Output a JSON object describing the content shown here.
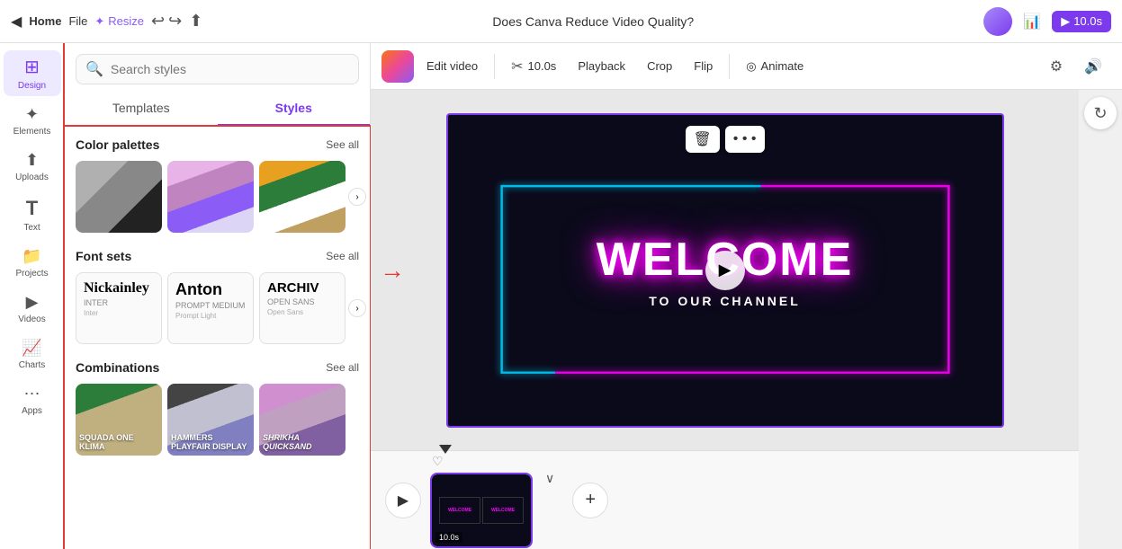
{
  "topbar": {
    "back_label": "◀",
    "home_label": "Home",
    "file_label": "File",
    "resize_icon": "✦",
    "resize_label": "Resize",
    "undo_icon": "↩",
    "redo_icon": "↪",
    "cloud_icon": "⬆",
    "title": "Does Canva Reduce Video Quality?",
    "chart_icon": "📊",
    "play_icon": "▶",
    "duration_label": "10.0s"
  },
  "sidebar": {
    "items": [
      {
        "id": "design",
        "icon": "⊞",
        "label": "Design",
        "active": true
      },
      {
        "id": "elements",
        "icon": "✦",
        "label": "Elements",
        "active": false
      },
      {
        "id": "uploads",
        "icon": "⬆",
        "label": "Uploads",
        "active": false
      },
      {
        "id": "text",
        "icon": "T",
        "label": "Text",
        "active": false
      },
      {
        "id": "projects",
        "icon": "📁",
        "label": "Projects",
        "active": false
      },
      {
        "id": "videos",
        "icon": "▶",
        "label": "Videos",
        "active": false
      },
      {
        "id": "charts",
        "icon": "📈",
        "label": "Charts",
        "active": false
      },
      {
        "id": "apps",
        "icon": "⋯",
        "label": "Apps",
        "active": false
      }
    ]
  },
  "design_panel": {
    "search_placeholder": "Search styles",
    "tab_templates": "Templates",
    "tab_styles": "Styles",
    "active_tab": "Styles",
    "color_palettes_title": "Color palettes",
    "see_all_label": "See all",
    "font_sets_title": "Font sets",
    "combinations_title": "Combinations",
    "font_sets": [
      {
        "name": "Nickainley",
        "sub": "INTER",
        "sub2": "Inter"
      },
      {
        "name": "Anton",
        "sub": "Prompt Medium",
        "sub2": "Prompt Light"
      },
      {
        "name": "ARCHIV",
        "sub": "OPEN SANS",
        "sub2": "Open Sans"
      }
    ],
    "combinations": [
      {
        "text": "SQUADA ONE\nKlima"
      },
      {
        "text": "HAMMERS\nPlayfair Display"
      },
      {
        "text": "Shrikha\nQuicksand"
      }
    ]
  },
  "toolbar": {
    "edit_video_label": "Edit video",
    "scissors_icon": "✂",
    "duration_label": "10.0s",
    "playback_label": "Playback",
    "crop_label": "Crop",
    "flip_label": "Flip",
    "animate_icon": "◎",
    "animate_label": "Animate",
    "settings_icon": "⚙",
    "volume_icon": "🔊"
  },
  "canvas": {
    "welcome_text": "WELCOME",
    "sub_text": "TO OUR CHANNEL",
    "delete_icon": "🗑",
    "more_icon": "•••"
  },
  "timeline": {
    "play_icon": "▶",
    "add_icon": "+",
    "track1_label": "10.0s",
    "heart_icon": "♡"
  },
  "right_panel": {
    "refresh_icon": "↻",
    "settings_icon": "⚙",
    "volume_icon": "🔊"
  }
}
